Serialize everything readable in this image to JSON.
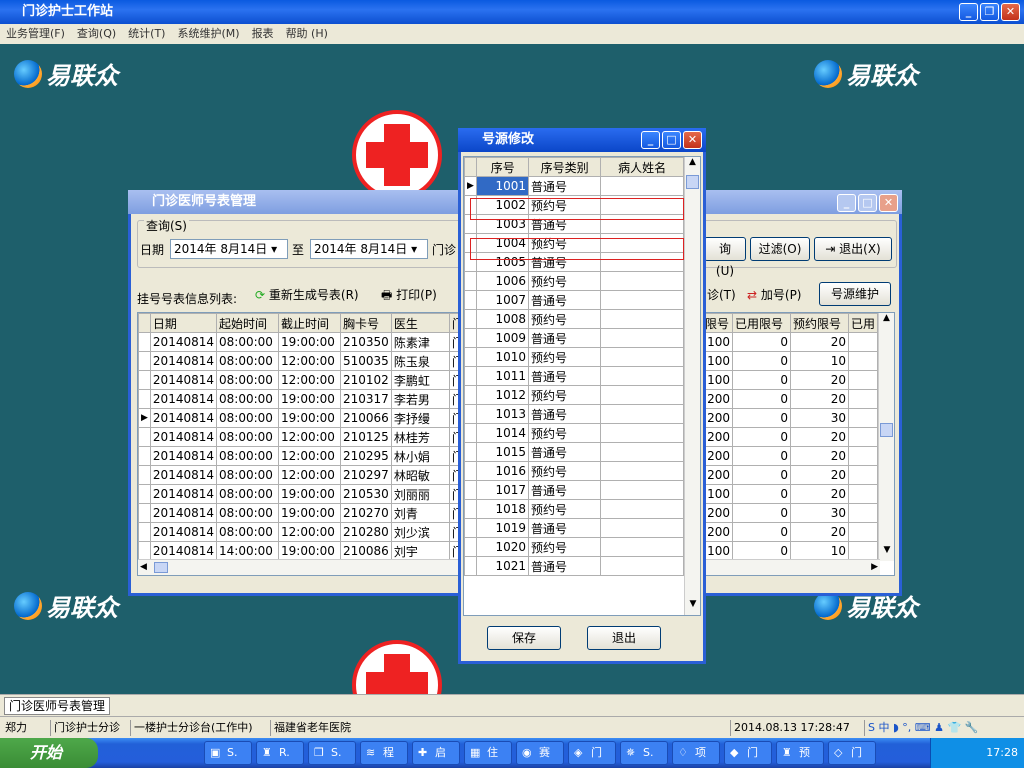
{
  "app": {
    "title": "门诊护士工作站",
    "menu": [
      "业务管理(F)",
      "查询(Q)",
      "统计(T)",
      "系统维护(M)",
      "报表",
      "帮助 (H)"
    ]
  },
  "desktop": {
    "logo": "易联众"
  },
  "schedule_window": {
    "title": "门诊医师号表管理",
    "query_group": "查询(S)",
    "date_label": "日期",
    "date_from": "2014年 8月14日",
    "to": "至",
    "date_to": "2014年 8月14日",
    "dept_label": "门诊",
    "query_btn": "询(U)",
    "filter_btn": "过滤(O)",
    "exit_btn": "退出(X)",
    "list_label": "挂号号表信息列表:",
    "regen_btn": "重新生成号表(R)",
    "print_btn": "打印(P)",
    "visit_btn": "诊(T)",
    "add_btn": "加号(P)",
    "maintain_btn": "号源维护",
    "left_headers": [
      "日期",
      "起始时间",
      "截止时间",
      "胸卡号",
      "医生",
      "门"
    ],
    "right_headers": [
      "限号",
      "已用限号",
      "预约限号",
      "已用"
    ],
    "rows": [
      [
        "20140814",
        "08:00:00",
        "19:00:00",
        "210350",
        "陈素津",
        "门",
        "100",
        "0",
        "20"
      ],
      [
        "20140814",
        "08:00:00",
        "12:00:00",
        "510035",
        "陈玉泉",
        "门",
        "100",
        "0",
        "10"
      ],
      [
        "20140814",
        "08:00:00",
        "12:00:00",
        "210102",
        "李鹏虹",
        "门",
        "100",
        "0",
        "20"
      ],
      [
        "20140814",
        "08:00:00",
        "19:00:00",
        "210317",
        "李若男",
        "门",
        "200",
        "0",
        "20"
      ],
      [
        "20140814",
        "08:00:00",
        "19:00:00",
        "210066",
        "李抒缦",
        "门",
        "200",
        "0",
        "30"
      ],
      [
        "20140814",
        "08:00:00",
        "12:00:00",
        "210125",
        "林桂芳",
        "门",
        "200",
        "0",
        "20"
      ],
      [
        "20140814",
        "08:00:00",
        "12:00:00",
        "210295",
        "林小娟",
        "门",
        "200",
        "0",
        "20"
      ],
      [
        "20140814",
        "08:00:00",
        "12:00:00",
        "210297",
        "林昭敏",
        "门",
        "200",
        "0",
        "20"
      ],
      [
        "20140814",
        "08:00:00",
        "19:00:00",
        "210530",
        "刘丽丽",
        "门",
        "100",
        "0",
        "20"
      ],
      [
        "20140814",
        "08:00:00",
        "19:00:00",
        "210270",
        "刘青",
        "门",
        "200",
        "0",
        "30"
      ],
      [
        "20140814",
        "08:00:00",
        "12:00:00",
        "210280",
        "刘少滨",
        "门",
        "200",
        "0",
        "20"
      ],
      [
        "20140814",
        "14:00:00",
        "19:00:00",
        "210086",
        "刘宇",
        "门",
        "100",
        "0",
        "10"
      ]
    ]
  },
  "source_dialog": {
    "title": "号源修改",
    "headers": [
      "序号",
      "序号类别",
      "病人姓名"
    ],
    "rows": [
      [
        "1001",
        "普通号",
        ""
      ],
      [
        "1002",
        "预约号",
        ""
      ],
      [
        "1003",
        "普通号",
        ""
      ],
      [
        "1004",
        "预约号",
        ""
      ],
      [
        "1005",
        "普通号",
        ""
      ],
      [
        "1006",
        "预约号",
        ""
      ],
      [
        "1007",
        "普通号",
        ""
      ],
      [
        "1008",
        "预约号",
        ""
      ],
      [
        "1009",
        "普通号",
        ""
      ],
      [
        "1010",
        "预约号",
        ""
      ],
      [
        "1011",
        "普通号",
        ""
      ],
      [
        "1012",
        "预约号",
        ""
      ],
      [
        "1013",
        "普通号",
        ""
      ],
      [
        "1014",
        "预约号",
        ""
      ],
      [
        "1015",
        "普通号",
        ""
      ],
      [
        "1016",
        "预约号",
        ""
      ],
      [
        "1017",
        "普通号",
        ""
      ],
      [
        "1018",
        "预约号",
        ""
      ],
      [
        "1019",
        "普通号",
        ""
      ],
      [
        "1020",
        "预约号",
        ""
      ],
      [
        "1021",
        "普通号",
        ""
      ]
    ],
    "save_btn": "保存",
    "exit_btn": "退出"
  },
  "mdi_tab": "门诊医师号表管理",
  "status": {
    "user": "郑力",
    "station": "门诊护士分诊",
    "desk": "一楼护士分诊台(工作中)",
    "hospital": "福建省老年医院",
    "datetime": "2014.08.13 17:28:47"
  },
  "taskbar": {
    "start": "开始",
    "items": [
      "S.",
      "R.",
      "S.",
      "程",
      "启",
      "住",
      "赛",
      "门",
      "S.",
      "项",
      "门",
      "预",
      "门"
    ],
    "time": "17:28"
  }
}
